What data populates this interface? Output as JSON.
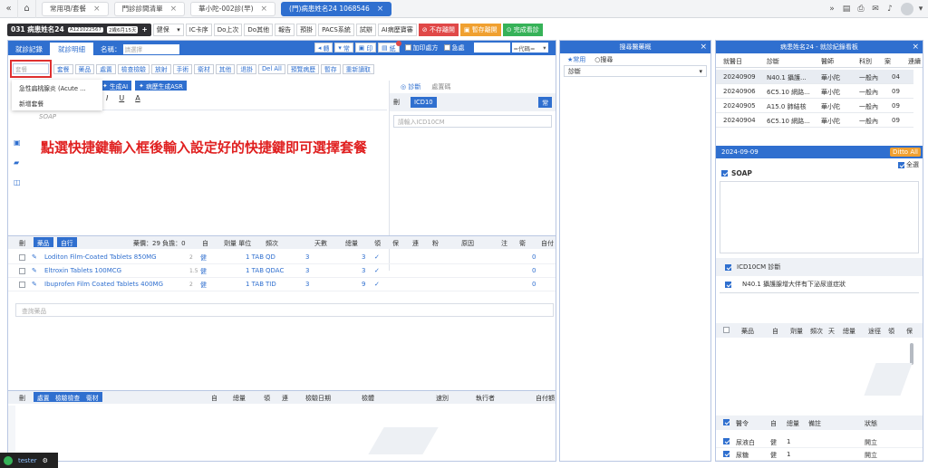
{
  "tabbar": {
    "left_icons": [
      "collapse-icon",
      "home-icon"
    ],
    "tabs": [
      {
        "label": "常用項/套餐",
        "active": false
      },
      {
        "label": "門診診間清單",
        "active": false
      },
      {
        "label": "華小陀-002診(早)",
        "active": false
      },
      {
        "label": "(門)病患姓名24 1068546",
        "active": true
      }
    ],
    "right_icons": [
      "expand-icon",
      "document-icon",
      "print-icon",
      "chat-icon",
      "bell-icon"
    ]
  },
  "toolbar": {
    "patient_name": "031 病患姓名24",
    "patient_id": "A121022567",
    "patient_age": "2歲6月15天",
    "insurance": "健保",
    "buttons": [
      "IC卡序",
      "Do上次",
      "Do其他",
      "報告",
      "預掛",
      "PACS系統",
      "試辦",
      "AI病歷寶審"
    ],
    "status_buttons": [
      "不存離開",
      "暫存離開",
      "完成看診"
    ]
  },
  "left": {
    "tabs": [
      "就診記錄",
      "就診明細"
    ],
    "name_label": "名稱：",
    "name_placeholder": "請選擇",
    "top_right_buttons": [
      "轉",
      "常",
      "印",
      "紙"
    ],
    "add_label": "加印處方",
    "urgent_label": "急處",
    "code_placeholder": "=代碼=",
    "set_placeholder": "套餐",
    "set_buttons": [
      "套餐",
      "藥品",
      "處置",
      "檢查檢驗",
      "放射",
      "手術",
      "衛材",
      "其他",
      "退掛",
      "Del All",
      "預覽病歷",
      "暫存",
      "重新讀取"
    ],
    "dropdown_items": [
      "急性扁桃腺炎 (Acute ...",
      "新增套餐"
    ],
    "ai_buttons": [
      "生成AI",
      "病歷生成ASR"
    ],
    "format_buttons": [
      "I",
      "U",
      "A"
    ],
    "soap_placeholder": "SOAP",
    "annotation": "點選快捷鍵輸入框後輸入設定好的快捷鍵即可選擇套餐",
    "side_icons": [
      "image-icon",
      "folder-icon",
      "save-icon"
    ],
    "dx_tabs": [
      "診斷",
      "處置碼"
    ],
    "dx_label": "刪",
    "dx_tag": "ICD10",
    "dx_right": "常",
    "dx_placeholder": "請輸入ICD10CM"
  },
  "meds": {
    "header": {
      "del": "刪",
      "tags": [
        "藥品",
        "自行"
      ],
      "days_info": "藥價：29 負擔：0",
      "self": "自",
      "dose_unit": "劑量 單位",
      "freq": "頻次",
      "days": "天數",
      "total": "總量",
      "take": "領",
      "keep": "保",
      "urgent": "連",
      "powder": "粉",
      "reason": "原因",
      "note": "注",
      "tag": "衛",
      "selfpay": "自付"
    },
    "rows": [
      {
        "name": "Loditon Film-Coated Tablets 850MG",
        "amt": "2",
        "unit": "健",
        "dose": "1 TAB",
        "freq": "QD",
        "days": "3",
        "total": "3",
        "check": "✓",
        "pay": "0"
      },
      {
        "name": "Eltroxin Tablets 100MCG",
        "amt": "1.5",
        "unit": "健",
        "dose": "1 TAB",
        "freq": "QDAC",
        "days": "3",
        "total": "3",
        "check": "✓",
        "pay": "0"
      },
      {
        "name": "Ibuprofen Film Coated Tablets 400MG",
        "amt": "2",
        "unit": "健",
        "dose": "1 TAB",
        "freq": "TID",
        "days": "3",
        "total": "9",
        "check": "✓",
        "pay": "0"
      }
    ],
    "search_placeholder": "查詢藥品"
  },
  "lab": {
    "del": "刪",
    "tags": [
      "處置",
      "檢驗檢查",
      "衛材"
    ],
    "cols": [
      "自",
      "總量",
      "領",
      "連",
      "檢驗日期",
      "檢體",
      "速別",
      "執行者",
      "自付額"
    ]
  },
  "middle": {
    "title": "搜尋醫藥概",
    "tabs": [
      "★常用",
      "○搜尋"
    ],
    "select_label": "診斷"
  },
  "right": {
    "title": "病患姓名24 - 就診紀錄看板",
    "cols": [
      "就醫日",
      "診斷",
      "醫師",
      "科別",
      "案",
      "連續"
    ],
    "rows": [
      [
        "20240909",
        "N40.1 攝護...",
        "華小陀",
        "一般內",
        "04"
      ],
      [
        "20240906",
        "6C5.10 網路...",
        "華小陀",
        "一般內",
        "09"
      ],
      [
        "20240905",
        "A15.0 肺結核",
        "華小陀",
        "一般內",
        "09"
      ],
      [
        "20240904",
        "6C5.10 網路...",
        "華小陀",
        "一般內",
        "09"
      ]
    ],
    "date": "2024-09-09",
    "ditto": "Ditto All",
    "all_label": "全選",
    "soap_label": "SOAP",
    "dx_header": "ICD10CM 診斷",
    "dx_item": "N40.1 攝護腺增大伴有下泌尿道症狀",
    "med_cols": [
      "藥品",
      "自",
      "劑量",
      "頻次",
      "天",
      "總量",
      "途徑",
      "領",
      "保"
    ],
    "order_cols": [
      "醫令",
      "自",
      "總量",
      "備註",
      "狀態"
    ],
    "orders": [
      {
        "name": "尿液白",
        "self": "健",
        "total": "1",
        "status": "開立"
      },
      {
        "name": "尿糖",
        "self": "健",
        "total": "1",
        "status": "開立"
      }
    ]
  },
  "user": {
    "name": "tester"
  }
}
